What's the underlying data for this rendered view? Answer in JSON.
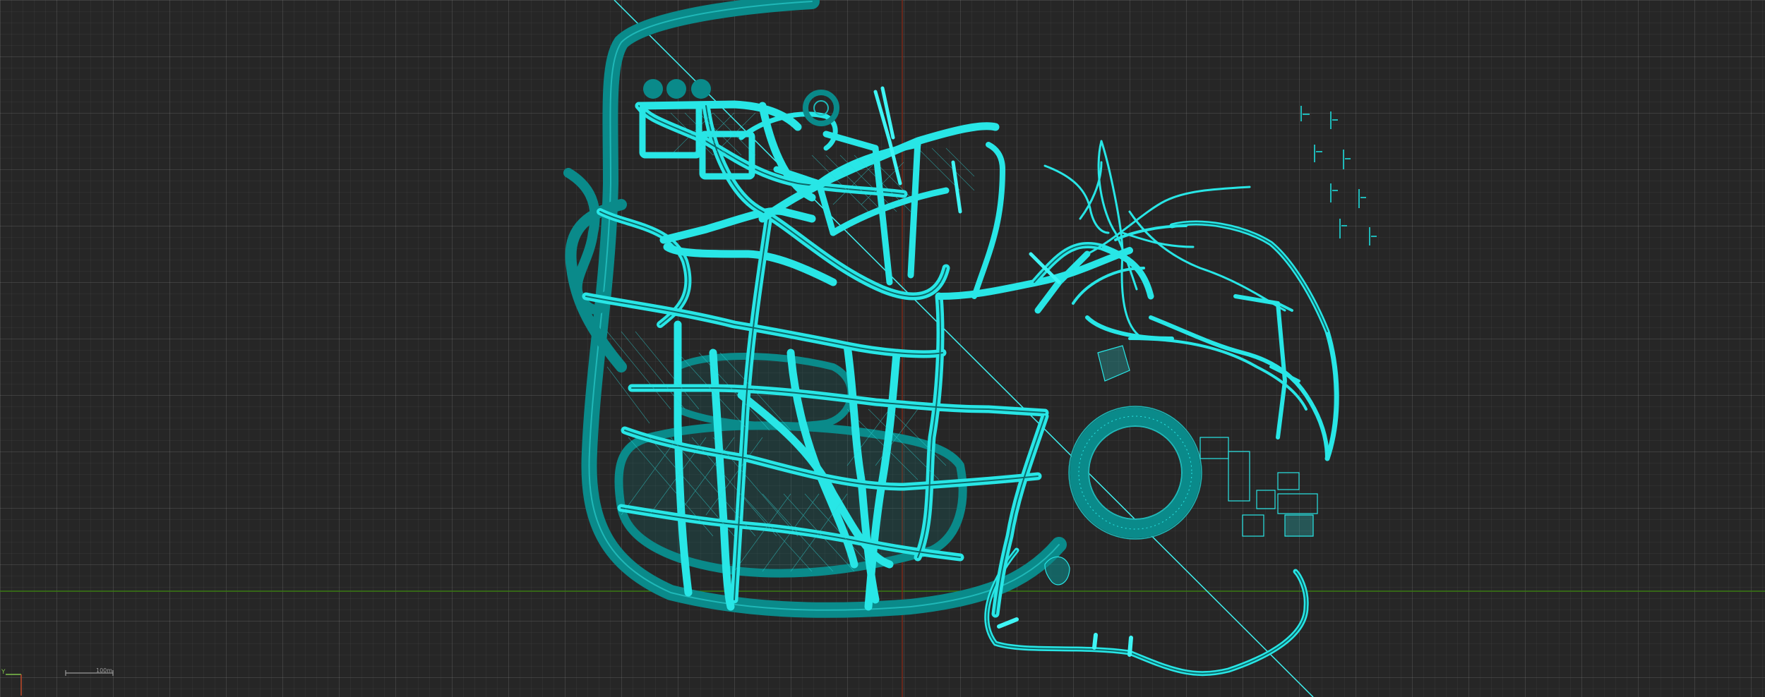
{
  "viewport": {
    "scale_bar_label": "100m",
    "axis_indicator": "Y",
    "colors": {
      "background": "#262626",
      "road_fill": "#0a8a8a",
      "road_outline": "#28e6e6",
      "road_bright": "#3ff5f5",
      "x_axis": "#2f6a10",
      "y_axis": "#7a2a1a"
    }
  }
}
